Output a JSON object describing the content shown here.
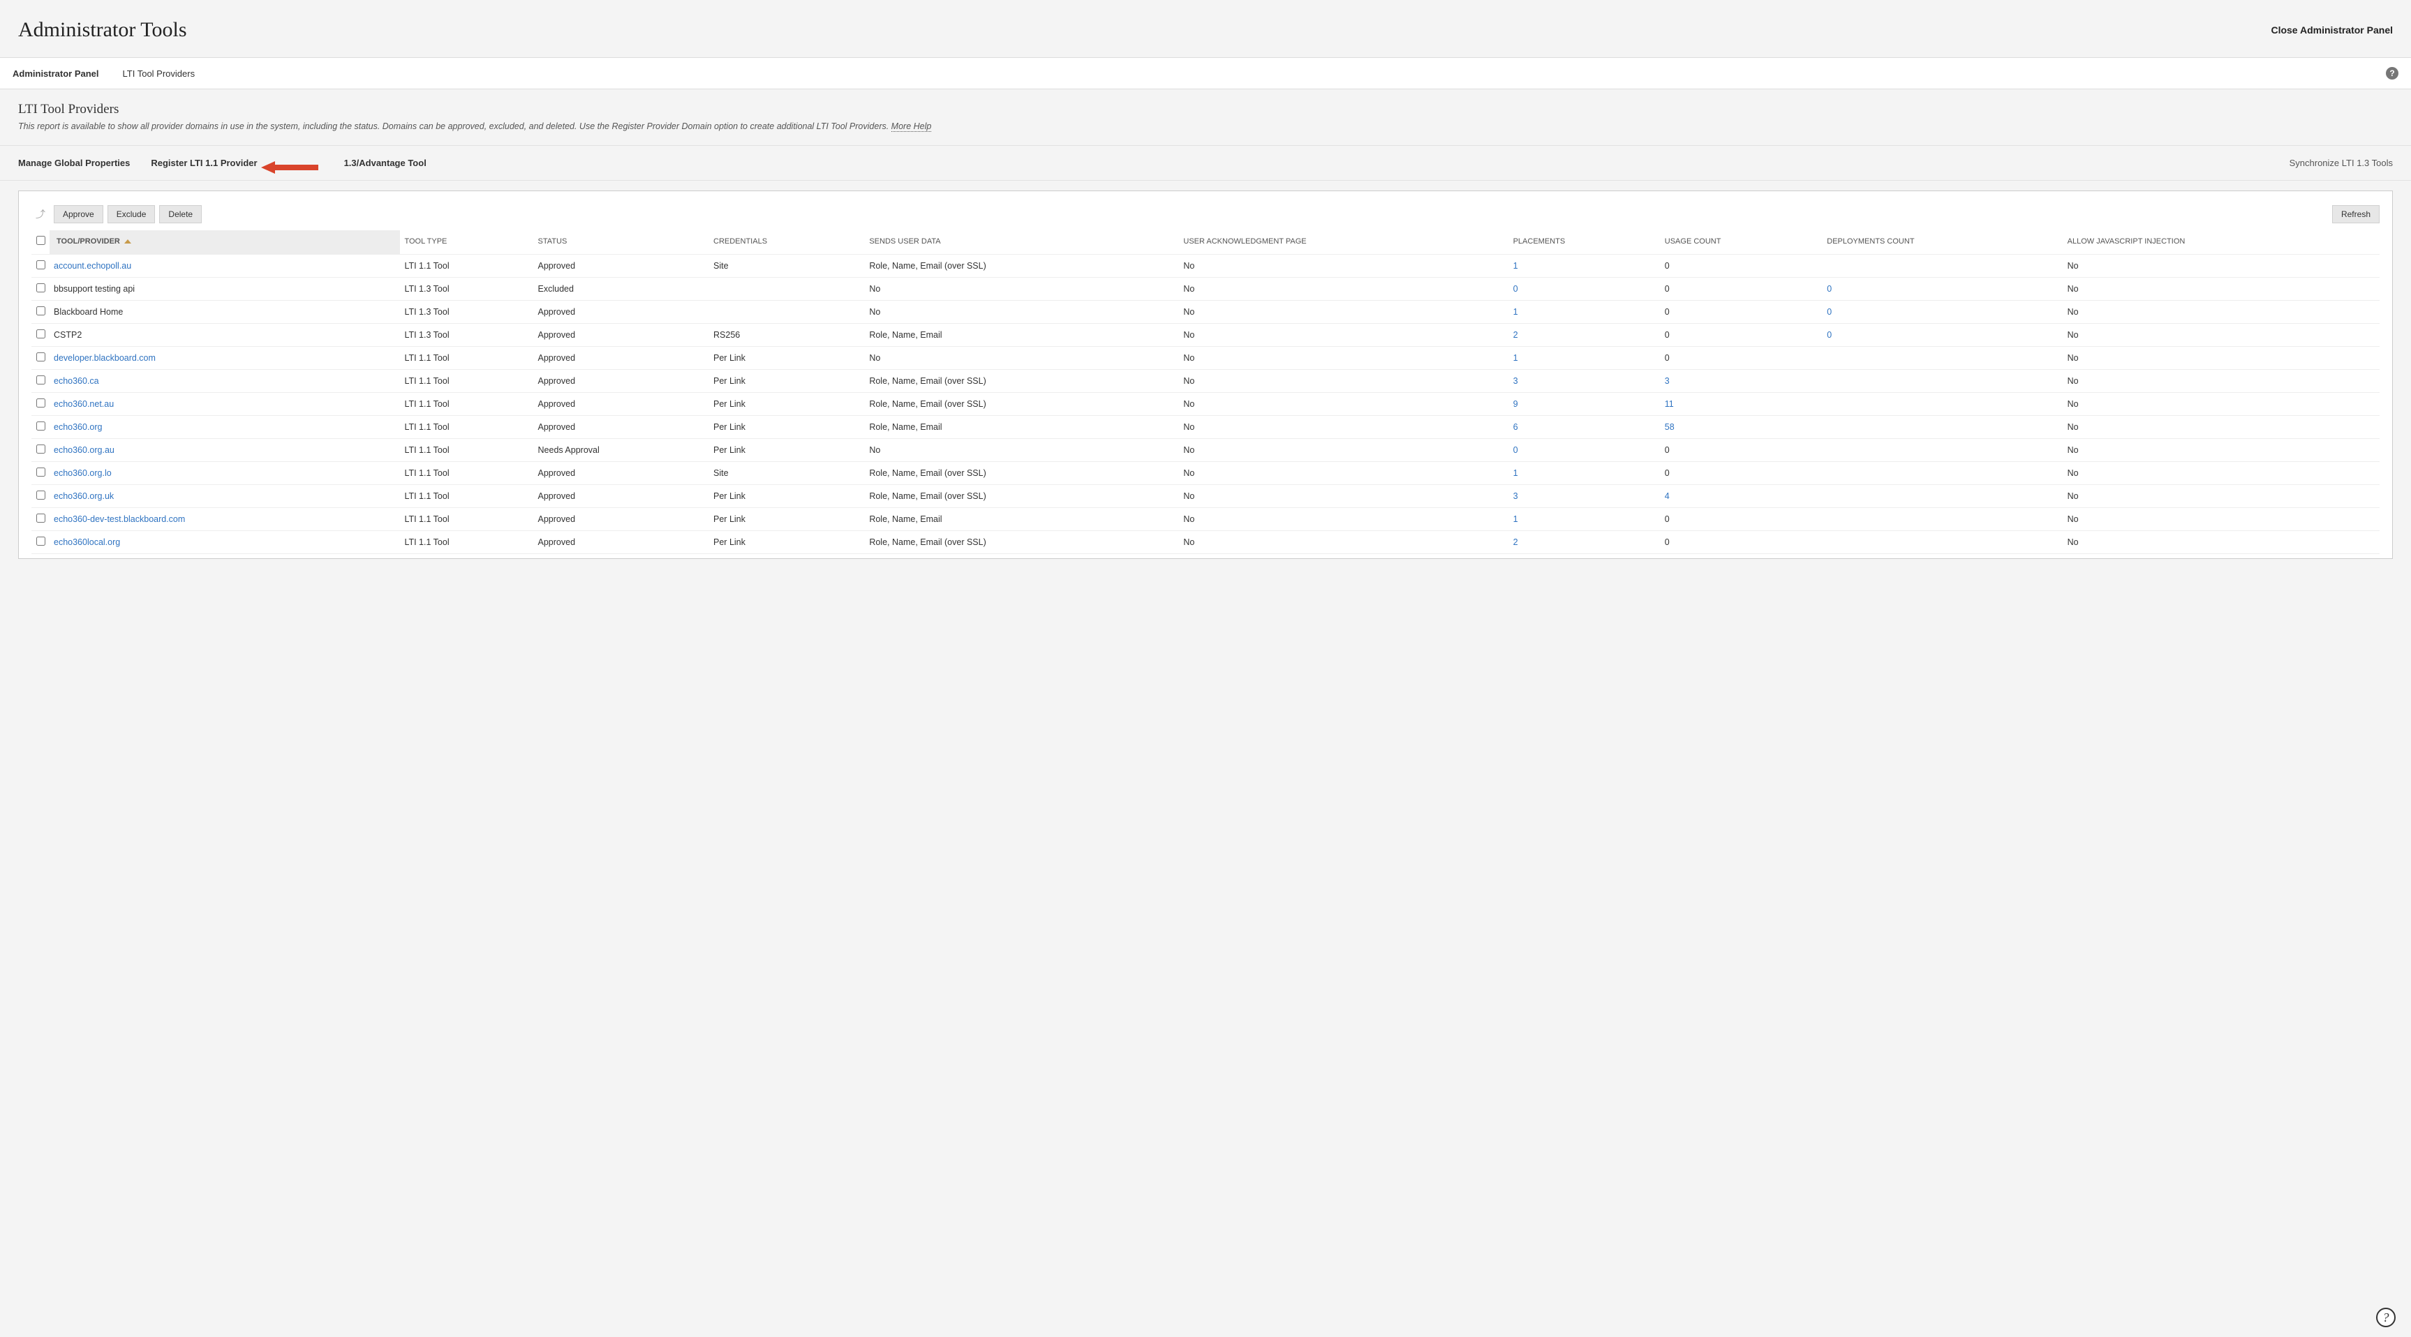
{
  "header": {
    "title": "Administrator Tools",
    "close_label": "Close Administrator Panel"
  },
  "breadcrumb": {
    "admin_panel": "Administrator Panel",
    "current": "LTI Tool Providers"
  },
  "section": {
    "title": "LTI Tool Providers",
    "desc": "This report is available to show all provider domains in use in the system, including the status. Domains can be approved, excluded, and deleted. Use the Register Provider Domain option to create additional LTI Tool Providers. ",
    "more_help": "More Help"
  },
  "actions": {
    "manage_global": "Manage Global Properties",
    "register_11": "Register LTI 1.1 Provider",
    "adv_suffix": "1.3/Advantage Tool",
    "sync": "Synchronize LTI 1.3 Tools"
  },
  "toolbar": {
    "approve": "Approve",
    "exclude": "Exclude",
    "delete": "Delete",
    "refresh": "Refresh"
  },
  "columns": {
    "tool": "TOOL/PROVIDER",
    "type": "TOOL TYPE",
    "status": "STATUS",
    "credentials": "CREDENTIALS",
    "sends": "SENDS USER DATA",
    "ack": "USER ACKNOWLEDGMENT PAGE",
    "placements": "PLACEMENTS",
    "usage": "USAGE COUNT",
    "deploy": "DEPLOYMENTS COUNT",
    "js": "ALLOW JAVASCRIPT INJECTION"
  },
  "rows": [
    {
      "tool": "account.echopoll.au",
      "tool_link": true,
      "type": "LTI 1.1 Tool",
      "status": "Approved",
      "cred": "Site",
      "sends": "Role, Name, Email (over SSL)",
      "ack": "No",
      "placements": "1",
      "p_link": true,
      "usage": "0",
      "u_link": false,
      "deploy": "",
      "d_link": false,
      "js": "No"
    },
    {
      "tool": "bbsupport testing api",
      "tool_link": false,
      "type": "LTI 1.3 Tool",
      "status": "Excluded",
      "cred": "",
      "sends": "No",
      "ack": "No",
      "placements": "0",
      "p_link": true,
      "usage": "0",
      "u_link": false,
      "deploy": "0",
      "d_link": true,
      "js": "No"
    },
    {
      "tool": "Blackboard Home",
      "tool_link": false,
      "type": "LTI 1.3 Tool",
      "status": "Approved",
      "cred": "",
      "sends": "No",
      "ack": "No",
      "placements": "1",
      "p_link": true,
      "usage": "0",
      "u_link": false,
      "deploy": "0",
      "d_link": true,
      "js": "No"
    },
    {
      "tool": "CSTP2",
      "tool_link": false,
      "type": "LTI 1.3 Tool",
      "status": "Approved",
      "cred": "RS256",
      "sends": "Role, Name, Email",
      "ack": "No",
      "placements": "2",
      "p_link": true,
      "usage": "0",
      "u_link": false,
      "deploy": "0",
      "d_link": true,
      "js": "No"
    },
    {
      "tool": "developer.blackboard.com",
      "tool_link": true,
      "type": "LTI 1.1 Tool",
      "status": "Approved",
      "cred": "Per Link",
      "sends": "No",
      "ack": "No",
      "placements": "1",
      "p_link": true,
      "usage": "0",
      "u_link": false,
      "deploy": "",
      "d_link": false,
      "js": "No"
    },
    {
      "tool": "echo360.ca",
      "tool_link": true,
      "type": "LTI 1.1 Tool",
      "status": "Approved",
      "cred": "Per Link",
      "sends": "Role, Name, Email (over SSL)",
      "ack": "No",
      "placements": "3",
      "p_link": true,
      "usage": "3",
      "u_link": true,
      "deploy": "",
      "d_link": false,
      "js": "No"
    },
    {
      "tool": "echo360.net.au",
      "tool_link": true,
      "type": "LTI 1.1 Tool",
      "status": "Approved",
      "cred": "Per Link",
      "sends": "Role, Name, Email (over SSL)",
      "ack": "No",
      "placements": "9",
      "p_link": true,
      "usage": "11",
      "u_link": true,
      "deploy": "",
      "d_link": false,
      "js": "No"
    },
    {
      "tool": "echo360.org",
      "tool_link": true,
      "type": "LTI 1.1 Tool",
      "status": "Approved",
      "cred": "Per Link",
      "sends": "Role, Name, Email",
      "ack": "No",
      "placements": "6",
      "p_link": true,
      "usage": "58",
      "u_link": true,
      "deploy": "",
      "d_link": false,
      "js": "No"
    },
    {
      "tool": "echo360.org.au",
      "tool_link": true,
      "type": "LTI 1.1 Tool",
      "status": "Needs Approval",
      "cred": "Per Link",
      "sends": "No",
      "ack": "No",
      "placements": "0",
      "p_link": true,
      "usage": "0",
      "u_link": false,
      "deploy": "",
      "d_link": false,
      "js": "No"
    },
    {
      "tool": "echo360.org.lo",
      "tool_link": true,
      "type": "LTI 1.1 Tool",
      "status": "Approved",
      "cred": "Site",
      "sends": "Role, Name, Email (over SSL)",
      "ack": "No",
      "placements": "1",
      "p_link": true,
      "usage": "0",
      "u_link": false,
      "deploy": "",
      "d_link": false,
      "js": "No"
    },
    {
      "tool": "echo360.org.uk",
      "tool_link": true,
      "type": "LTI 1.1 Tool",
      "status": "Approved",
      "cred": "Per Link",
      "sends": "Role, Name, Email (over SSL)",
      "ack": "No",
      "placements": "3",
      "p_link": true,
      "usage": "4",
      "u_link": true,
      "deploy": "",
      "d_link": false,
      "js": "No"
    },
    {
      "tool": "echo360-dev-test.blackboard.com",
      "tool_link": true,
      "type": "LTI 1.1 Tool",
      "status": "Approved",
      "cred": "Per Link",
      "sends": "Role, Name, Email",
      "ack": "No",
      "placements": "1",
      "p_link": true,
      "usage": "0",
      "u_link": false,
      "deploy": "",
      "d_link": false,
      "js": "No"
    },
    {
      "tool": "echo360local.org",
      "tool_link": true,
      "type": "LTI 1.1 Tool",
      "status": "Approved",
      "cred": "Per Link",
      "sends": "Role, Name, Email (over SSL)",
      "ack": "No",
      "placements": "2",
      "p_link": true,
      "usage": "0",
      "u_link": false,
      "deploy": "",
      "d_link": false,
      "js": "No"
    }
  ]
}
